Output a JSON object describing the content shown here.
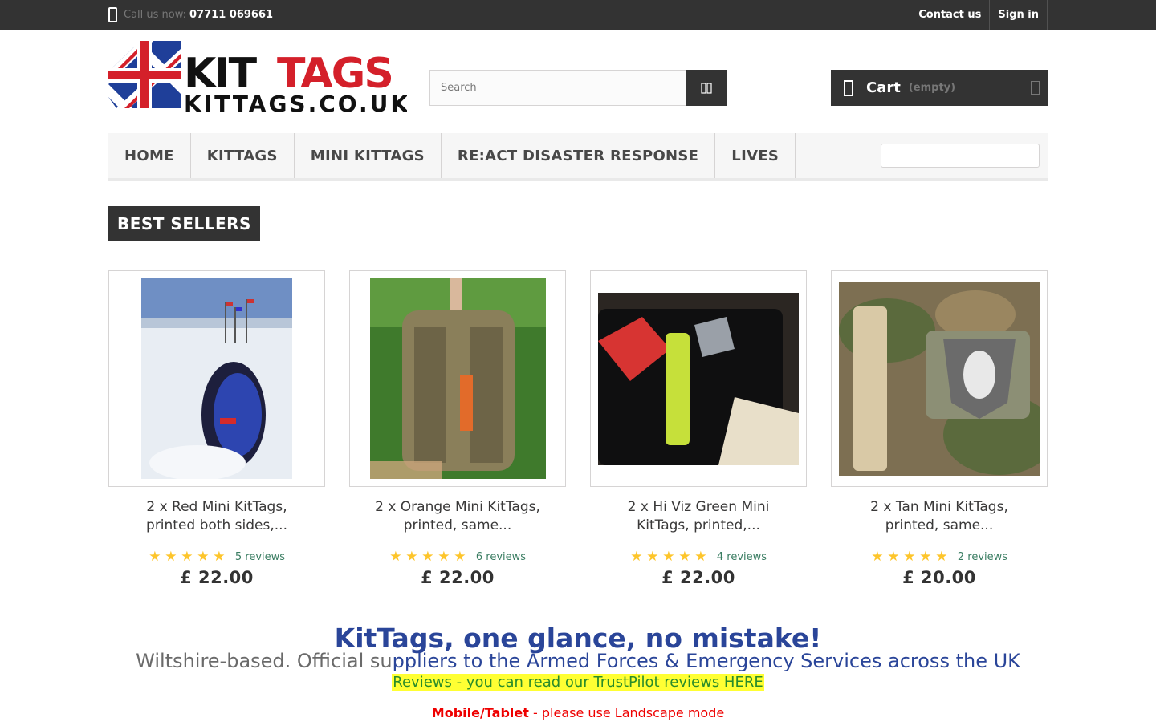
{
  "topbar": {
    "call_label": "Call us now:",
    "phone": "07711 069661",
    "links": {
      "contact": "Contact us",
      "signin": "Sign in"
    }
  },
  "header": {
    "logo_text_main": "KITTAGS",
    "logo_text_sub": "KITTAGS.CO.UK",
    "search_placeholder": "Search",
    "cart_label": "Cart",
    "cart_status": "(empty)"
  },
  "nav": {
    "items": [
      "HOME",
      "KITTAGS",
      "MINI KITTAGS",
      "RE:ACT DISASTER RESPONSE",
      "LIVES"
    ]
  },
  "section_title": "BEST SELLERS",
  "products": [
    {
      "name": "2 x Red Mini KitTags, printed both sides,...",
      "reviews": "5 reviews",
      "price": "£ 22.00",
      "rating": 5
    },
    {
      "name": "2 x Orange Mini KitTags, printed, same...",
      "reviews": "6 reviews",
      "price": "£ 22.00",
      "rating": 5
    },
    {
      "name": "2 x Hi Viz Green Mini KitTags, printed,...",
      "reviews": "4 reviews",
      "price": "£ 22.00",
      "rating": 5
    },
    {
      "name": "2 x Tan Mini KitTags, printed, same...",
      "reviews": "2 reviews",
      "price": "£ 20.00",
      "rating": 5
    }
  ],
  "tagline": {
    "headline": "KitTags, one glance, no mistake!",
    "sub_grey": "Wiltshire-based. Official su",
    "sub_blue": "ppliers to the Armed Forces & Emergency Services across the UK",
    "reviews_line": "Reviews - you can read our TrustPilot reviews HERE",
    "mobile_bold": "Mobile/Tablet",
    "mobile_rest": " - please use Landscape mode"
  },
  "colors": {
    "dark": "#333333",
    "accent_blue": "#2a4599",
    "star": "#fdc52b",
    "review_green": "#3a7d62",
    "highlight": "#ffff33"
  }
}
